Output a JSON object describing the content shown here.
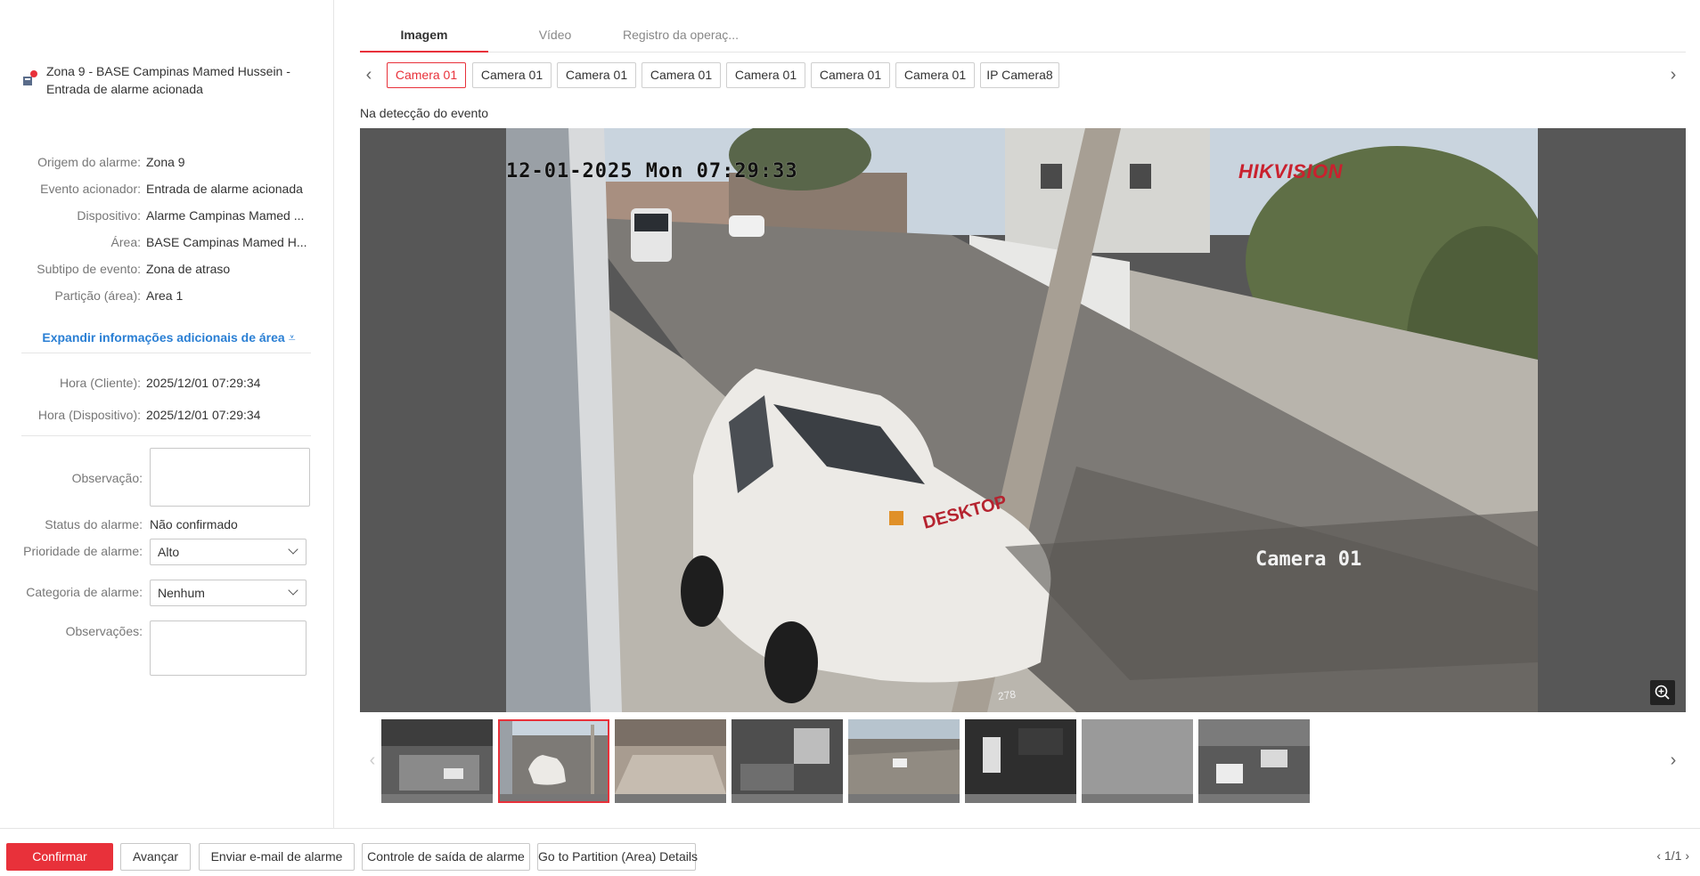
{
  "alarm": {
    "title_line1": "Zona 9 - BASE Campinas Mamed Hussein -",
    "title_line2": "Entrada de alarme acionada"
  },
  "info": [
    {
      "label": "Origem do alarme:",
      "value": "Zona 9"
    },
    {
      "label": "Evento acionador:",
      "value": "Entrada de alarme acionada"
    },
    {
      "label": "Dispositivo:",
      "value": "Alarme Campinas Mamed ..."
    },
    {
      "label": "Área:",
      "value": "BASE Campinas Mamed H..."
    },
    {
      "label": "Subtipo de evento:",
      "value": "Zona de atraso"
    },
    {
      "label": "Partição (área):",
      "value": "Area 1"
    }
  ],
  "expand_label": "Expandir informações adicionais de área",
  "times": [
    {
      "label": "Hora (Cliente):",
      "value": "2025/12/01 07:29:34"
    },
    {
      "label": "Hora (Dispositivo):",
      "value": "2025/12/01 07:29:34"
    }
  ],
  "form": {
    "observacao_label": "Observação:",
    "observacao_value": "",
    "status_label": "Status do alarme:",
    "status_value": "Não confirmado",
    "prioridade_label": "Prioridade de alarme:",
    "prioridade_value": "Alto",
    "categoria_label": "Categoria de alarme:",
    "categoria_value": "Nenhum",
    "observacoes_label": "Observações:",
    "observacoes_value": ""
  },
  "tabs": [
    "Imagem",
    "Vídeo",
    "Registro da operaç..."
  ],
  "cameras": [
    "Camera 01",
    "Camera 01",
    "Camera 01",
    "Camera 01",
    "Camera 01",
    "Camera 01",
    "Camera 01",
    "IP Camera8"
  ],
  "detect_label": "Na detecção do evento",
  "viewer": {
    "osd_time": "12-01-2025 Mon 07:29:33",
    "osd_brand": "HIKVISION",
    "osd_camera": "Camera 01",
    "car_text": "DESKTOP",
    "plate_text": "278"
  },
  "footer": {
    "confirm": "Confirmar",
    "next": "Avançar",
    "email": "Enviar e-mail de alarme",
    "output": "Controle de saída de alarme",
    "partition": "Go to Partition (Area) Details",
    "pager": "1/1"
  },
  "colors": {
    "accent": "#e8313a",
    "link": "#2a7fd4"
  }
}
